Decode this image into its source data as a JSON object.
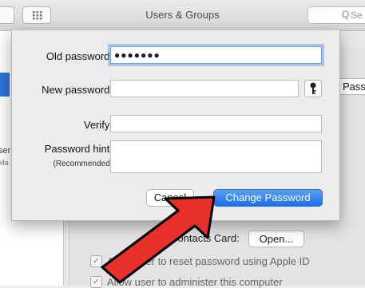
{
  "window": {
    "title": "Users & Groups",
    "search_icon_glyph": "Q",
    "search_placeholder": "Se"
  },
  "left_pane": {
    "partial_text_1": "ser",
    "partial_text_2": "Ma"
  },
  "background": {
    "passw_button": "Passw",
    "contacts_card_label": "Contacts Card:",
    "open_button": "Open...",
    "checkbox_1_label": "Allow user to reset password using Apple ID",
    "checkbox_2_label": "Allow user to administer this computer",
    "check_glyph": "✓"
  },
  "dialog": {
    "old_password_label": "Old password:",
    "old_password_value": "●●●●●●●",
    "new_password_label": "New password:",
    "new_password_value": "",
    "verify_label": "Verify:",
    "verify_value": "",
    "hint_label": "Password hint:",
    "hint_sublabel": "(Recommended)",
    "cancel_label": "Cancel",
    "change_password_label": "Change Password"
  },
  "colors": {
    "accent": "#1c6fe6",
    "arrow": "#e8302a"
  }
}
